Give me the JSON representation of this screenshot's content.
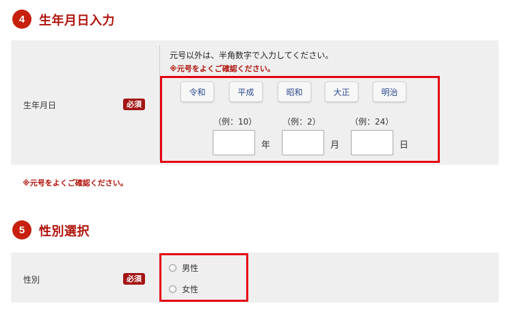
{
  "section_birthdate": {
    "number": "4",
    "title": "生年月日入力",
    "row_label": "生年月日",
    "required_badge": "必須",
    "instruction": "元号以外は、半角数字で入力してください。",
    "era_notice": "※元号をよくご確認ください。",
    "era_buttons": [
      "令和",
      "平成",
      "昭和",
      "大正",
      "明治"
    ],
    "fields": [
      {
        "example": "（例：10）",
        "unit": "年",
        "value": ""
      },
      {
        "example": "（例：2）",
        "unit": "月",
        "value": ""
      },
      {
        "example": "（例：24）",
        "unit": "日",
        "value": ""
      }
    ],
    "footnote": "※元号をよくご確認ください。"
  },
  "section_gender": {
    "number": "5",
    "title": "性別選択",
    "row_label": "性別",
    "required_badge": "必須",
    "options": [
      "男性",
      "女性"
    ],
    "selected": null
  },
  "colors": {
    "accent_red": "#c8200e",
    "title_red": "#b0130a",
    "highlight_frame": "#e6000f",
    "panel_bg": "#efefef",
    "era_button_text": "#2b4a8f"
  }
}
